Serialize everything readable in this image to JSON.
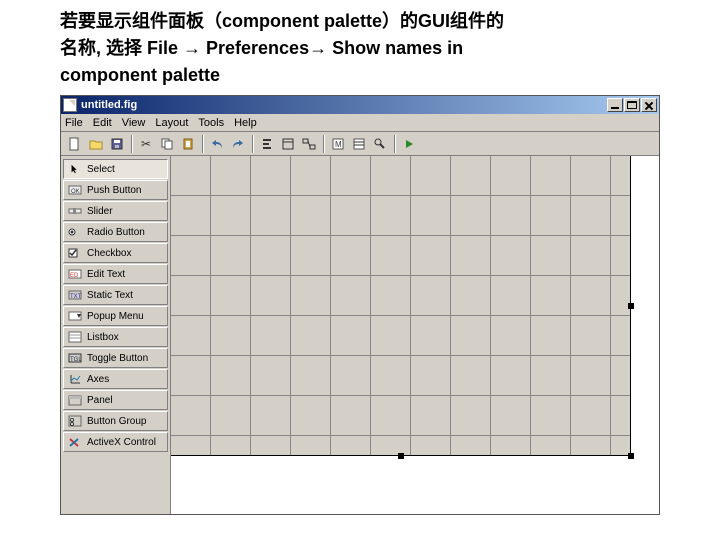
{
  "caption": {
    "line1": "若要显示组件面板（component palette）的GUI组件的",
    "line2": "名称, 选择 File → Preferences→ Show names in",
    "line3": "component palette"
  },
  "window": {
    "title": "untitled.fig"
  },
  "menu": {
    "items": [
      "File",
      "Edit",
      "View",
      "Layout",
      "Tools",
      "Help"
    ]
  },
  "palette": {
    "items": [
      {
        "label": "Select",
        "kind": "cursor"
      },
      {
        "label": "Push Button",
        "kind": "push"
      },
      {
        "label": "Slider",
        "kind": "slider"
      },
      {
        "label": "Radio Button",
        "kind": "radio"
      },
      {
        "label": "Checkbox",
        "kind": "check"
      },
      {
        "label": "Edit Text",
        "kind": "edit"
      },
      {
        "label": "Static Text",
        "kind": "static"
      },
      {
        "label": "Popup Menu",
        "kind": "popup"
      },
      {
        "label": "Listbox",
        "kind": "listbox"
      },
      {
        "label": "Toggle Button",
        "kind": "toggle"
      },
      {
        "label": "Axes",
        "kind": "axes"
      },
      {
        "label": "Panel",
        "kind": "panel"
      },
      {
        "label": "Button Group",
        "kind": "group"
      },
      {
        "label": "ActiveX Control",
        "kind": "activex"
      }
    ]
  }
}
